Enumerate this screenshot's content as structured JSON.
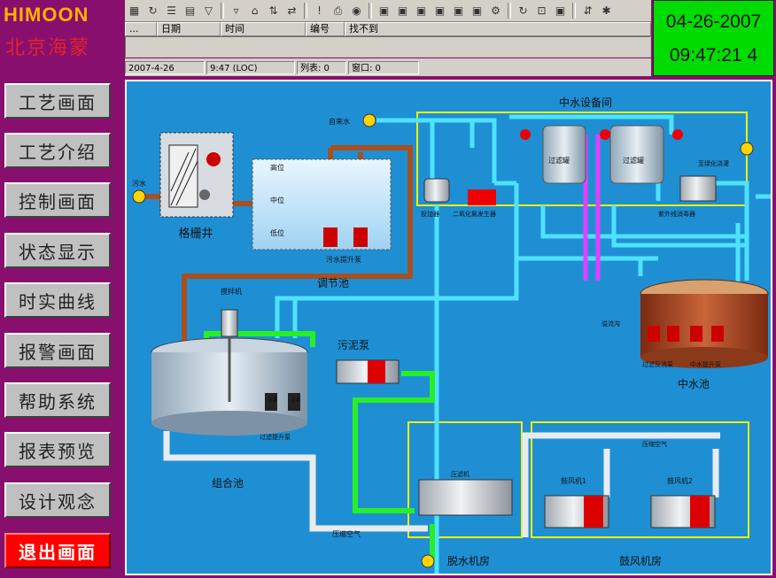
{
  "brand": {
    "en": "HIMOON",
    "cn": "北京海蒙"
  },
  "clock": {
    "date": "04-26-2007",
    "time": "09:47:21 4"
  },
  "alarm_table": {
    "columns": [
      "...",
      "日期",
      "时间",
      "编号",
      "找不到"
    ]
  },
  "status_bar": {
    "date": "2007-4-26",
    "time": "9:47 (LOC)",
    "list": "列表: 0",
    "window": "窗口: 0"
  },
  "toolbar_icons": [
    "grid-icon",
    "refresh-icon",
    "list-icon",
    "chart-icon",
    "filter-icon",
    "filter-clear-icon",
    "tag-icon",
    "sort-icon",
    "swap-icon",
    "info-icon",
    "print-icon",
    "alarm-bell-icon",
    "panel-icon",
    "panel-icon",
    "panel-icon",
    "panel-icon",
    "panel-icon",
    "panel-icon",
    "settings-icon",
    "refresh-icon",
    "lock-icon",
    "panel-icon",
    "sort-az-icon",
    "tools-icon"
  ],
  "nav": {
    "items": [
      "工艺画面",
      "工艺介绍",
      "控制画面",
      "状态显示",
      "时实曲线",
      "报警画面",
      "帮助系统",
      "报表预览",
      "设计观念"
    ],
    "exit": "退出画面"
  },
  "diagram": {
    "reclaimed_room": "中水设备间",
    "tap_water": "自来水",
    "sewage": "污水",
    "screen_well": "格栅井",
    "level_high": "高位",
    "level_mid": "中位",
    "level_low": "低位",
    "sewage_pump": "污水提升泵",
    "regulation_tank": "调节池",
    "mixer": "搅拌机",
    "sludge_pump": "污泥泵",
    "lift_pump": "过滤提升泵",
    "combined_tank": "组合池",
    "compressed_air": "压缩空气",
    "dewater_room": "脱水机房",
    "blower_room": "鼓风机房",
    "press": "压滤机",
    "blower1": "鼓风机1",
    "blower2": "鼓风机2",
    "filter": "过滤罐",
    "disinfect": "二氧化氯发生器",
    "dosing": "投加器",
    "uv_device": "紫外线消毒器",
    "to_irrigation": "至绿化浇灌",
    "drain": "溢流沟",
    "backwash_pump": "过滤反洗泵",
    "reuse_pump": "中水提升泵",
    "reclaimed_tank": "中水池",
    "pump1": "1#",
    "pump2": "2#"
  }
}
